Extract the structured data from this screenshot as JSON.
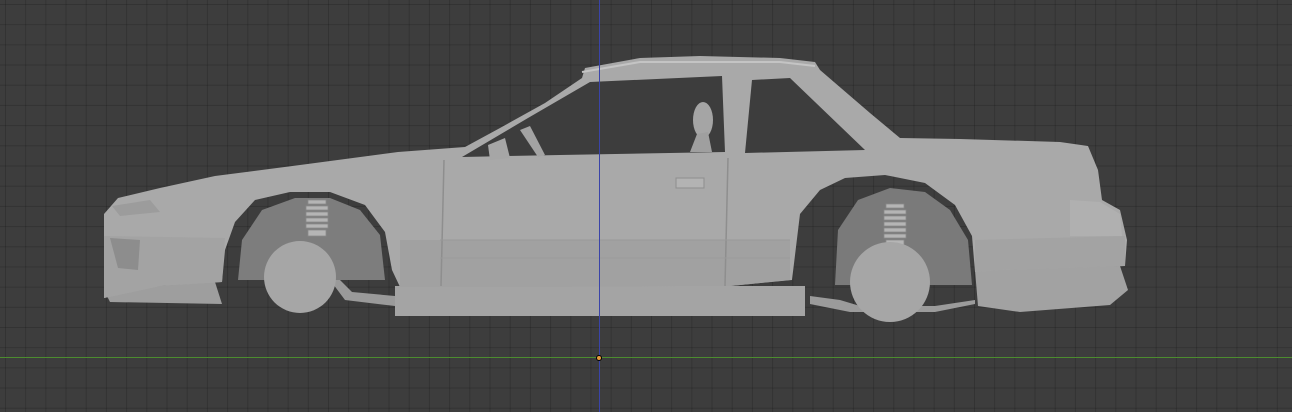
{
  "viewport": {
    "background_color": "#3d3d3d",
    "grid_color": "#333333",
    "view": "right-orthographic"
  },
  "axes": {
    "x_axis_color": "#4c8c2f",
    "z_axis_color": "#3a44a8"
  },
  "origin": {
    "color": "#e89a3c"
  },
  "model": {
    "name": "car-body-mesh",
    "shading": "solid",
    "body_color": "#a9a9a9",
    "shadow_color": "#8a8a8a",
    "window_color": "#3d3d3d"
  }
}
